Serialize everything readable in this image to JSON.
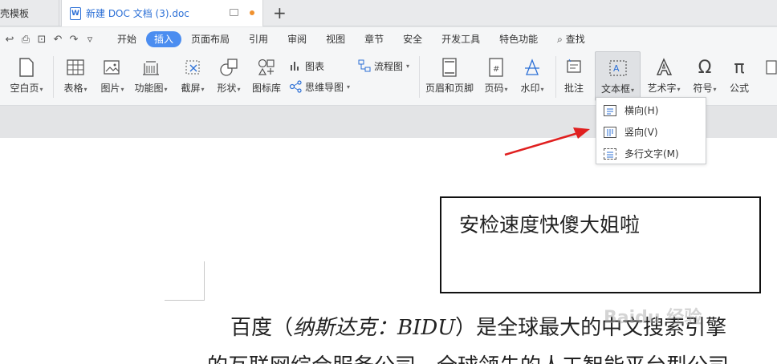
{
  "tabs": {
    "left_tab": "壳模板",
    "active_tab": "新建 DOC 文档 (3).doc",
    "doc_icon_letter": "W",
    "new_tab": "+"
  },
  "menu": {
    "quick_access_icons": [
      "undo-redo-icon",
      "print-icon",
      "print-preview-icon",
      "undo-icon",
      "redo-icon",
      "more-icon"
    ],
    "items": [
      "开始",
      "插入",
      "页面布局",
      "引用",
      "审阅",
      "视图",
      "章节",
      "安全",
      "开发工具",
      "特色功能"
    ],
    "active": "插入",
    "search": "查找",
    "accent_color": "#4b8df0"
  },
  "ribbon": {
    "blank_page": "空白页",
    "table": "表格",
    "picture": "图片",
    "function_chart": "功能图",
    "screenshot": "截屏",
    "shape": "形状",
    "icon_library": "图标库",
    "chart": "图表",
    "mind_map": "思维导图",
    "flowchart": "流程图",
    "header_footer": "页眉和页脚",
    "page_number": "页码",
    "watermark": "水印",
    "comment": "批注",
    "textbox": "文本框",
    "wordart": "艺术字",
    "symbol": "符号",
    "formula": "公式"
  },
  "dropdown": {
    "items": [
      "横向(H)",
      "竖向(V)",
      "多行文字(M)"
    ]
  },
  "document": {
    "textbox_text": "安检速度快傻大姐啦",
    "para_start": "百度（",
    "para_italic": "纳斯达克：BIDU",
    "para_end": "）是全球最大的中文搜索引擎",
    "para_line2": "的互联网综合服务公司，全球领先的人工智能平台型公司",
    "watermark_text": "Baidu 经验"
  },
  "annotation": {
    "arrow_color": "#e02020"
  }
}
